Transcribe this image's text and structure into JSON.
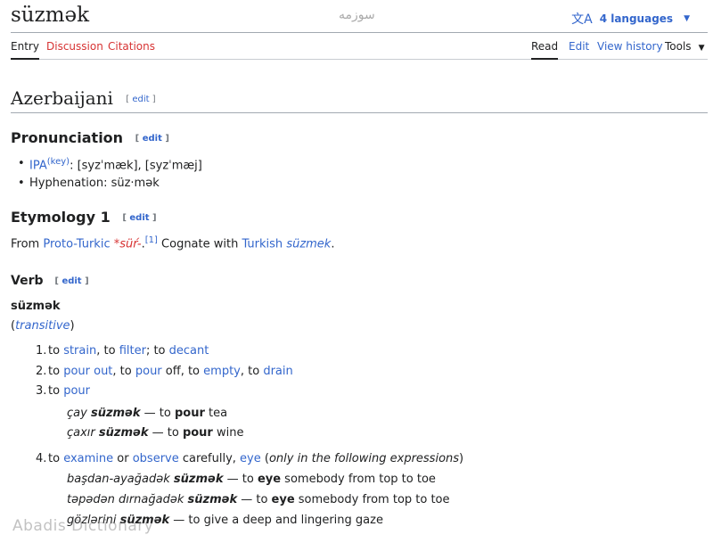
{
  "page": {
    "title": "süzmək",
    "persian": "سوزمه",
    "languages_label": "4 languages",
    "tabs": {
      "entry": "Entry",
      "discussion": "Discussion",
      "citations": "Citations",
      "read": "Read",
      "edit": "Edit",
      "history": "View history",
      "tools": "Tools"
    }
  },
  "content": {
    "lang_heading": "Azerbaijani",
    "edit": "edit",
    "pron_heading": "Pronunciation",
    "ipa_link": "IPA",
    "ipa_key": "(key)",
    "ipa_text": ": [syzˈmæk], [syzˈmæj]",
    "hyphenation": "Hyphenation: süz‧mək",
    "etym_heading": "Etymology 1",
    "etym": {
      "from": "From ",
      "proto": "Proto-Turkic",
      "root": "*süŕ-",
      "dot": ".",
      "ref": "[1]",
      "cognate": " Cognate with ",
      "turkish": "Turkish",
      "turk_word": "süzmek",
      "end": "."
    },
    "verb_heading": "Verb",
    "headword": "süzmək",
    "transitive": "transitive",
    "senses": [
      {
        "num": "1."
      },
      {
        "num": "2."
      },
      {
        "num": "3."
      },
      {
        "num": "4."
      }
    ],
    "s1": [
      "to ",
      "strain",
      ", to ",
      "filter",
      "; to ",
      "decant"
    ],
    "s2": [
      "to ",
      "pour out",
      ", to ",
      "pour",
      " off, to ",
      "empty",
      ", to ",
      "drain"
    ],
    "s3": [
      "to ",
      "pour"
    ],
    "ex3a": [
      "çay ",
      "süzmək",
      " — to ",
      "pour",
      " tea"
    ],
    "ex3b": [
      "çaxır ",
      "süzmək",
      " — to ",
      "pour",
      " wine"
    ],
    "s4": [
      "to ",
      "examine",
      " or ",
      "observe",
      " carefully, ",
      "eye",
      " (",
      "only in the following expressions",
      ")"
    ],
    "ex4a": [
      "başdan-ayağadək ",
      "süzmək",
      " — to ",
      "eye",
      " somebody from top to toe"
    ],
    "ex4b": [
      "təpədən dırnağadək ",
      "süzmək",
      " — to ",
      "eye",
      " somebody from top to toe"
    ],
    "ex4c": [
      "gözlərini ",
      "süzmək",
      " — to give a deep and lingering gaze"
    ]
  },
  "watermark": "Abadis Dictionary"
}
